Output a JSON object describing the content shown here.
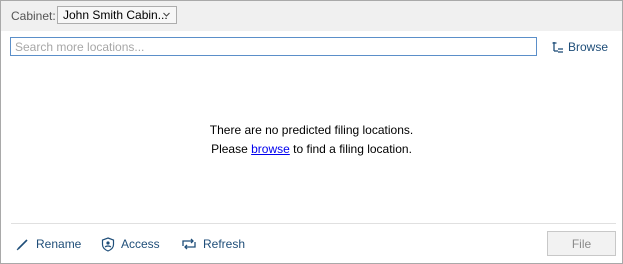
{
  "header": {
    "cabinet_label": "Cabinet:",
    "cabinet_value": "John Smith Cabin..."
  },
  "search": {
    "placeholder": "Search more locations...",
    "value": ""
  },
  "browse_label": "Browse",
  "empty_state": {
    "line1": "There are no predicted filing locations.",
    "line2_prefix": "Please",
    "line2_link": "browse",
    "line2_suffix": "to find a filing location."
  },
  "actions": {
    "rename": "Rename",
    "access": "Access",
    "refresh": "Refresh",
    "file": "File"
  },
  "icons": {
    "cabinet_dropdown": "chevron-down-icon",
    "browse": "tree-browse-icon",
    "rename": "pencil-icon",
    "access": "shield-user-icon",
    "refresh": "refresh-arrows-icon"
  },
  "colors": {
    "accent_text": "#1f4e79",
    "link": "#0000ee",
    "input_border": "#5b8fc9",
    "disabled_text": "#8a8a8a"
  }
}
